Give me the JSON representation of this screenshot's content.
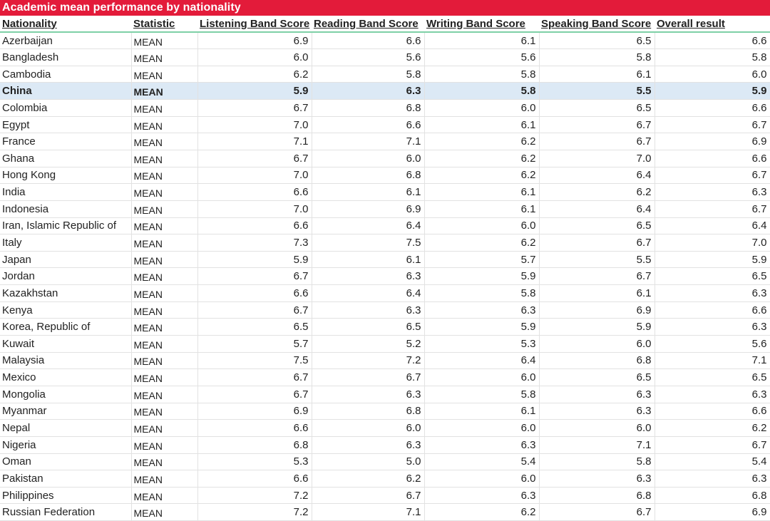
{
  "title": "Academic mean performance by nationality",
  "accent": "#e31b3a",
  "highlight_row": "China",
  "columns": [
    "Nationality",
    "Statistic",
    "Listening Band Score",
    "Reading Band Score",
    "Writing Band Score",
    "Speaking Band Score",
    "Overall result"
  ],
  "rows": [
    [
      "Azerbaijan",
      "MEAN",
      "6.9",
      "6.6",
      "6.1",
      "6.5",
      "6.6"
    ],
    [
      "Bangladesh",
      "MEAN",
      "6.0",
      "5.6",
      "5.6",
      "5.8",
      "5.8"
    ],
    [
      "Cambodia",
      "MEAN",
      "6.2",
      "5.8",
      "5.8",
      "6.1",
      "6.0"
    ],
    [
      "China",
      "MEAN",
      "5.9",
      "6.3",
      "5.8",
      "5.5",
      "5.9"
    ],
    [
      "Colombia",
      "MEAN",
      "6.7",
      "6.8",
      "6.0",
      "6.5",
      "6.6"
    ],
    [
      "Egypt",
      "MEAN",
      "7.0",
      "6.6",
      "6.1",
      "6.7",
      "6.7"
    ],
    [
      "France",
      "MEAN",
      "7.1",
      "7.1",
      "6.2",
      "6.7",
      "6.9"
    ],
    [
      "Ghana",
      "MEAN",
      "6.7",
      "6.0",
      "6.2",
      "7.0",
      "6.6"
    ],
    [
      "Hong Kong",
      "MEAN",
      "7.0",
      "6.8",
      "6.2",
      "6.4",
      "6.7"
    ],
    [
      "India",
      "MEAN",
      "6.6",
      "6.1",
      "6.1",
      "6.2",
      "6.3"
    ],
    [
      "Indonesia",
      "MEAN",
      "7.0",
      "6.9",
      "6.1",
      "6.4",
      "6.7"
    ],
    [
      "Iran, Islamic Republic of",
      "MEAN",
      "6.6",
      "6.4",
      "6.0",
      "6.5",
      "6.4"
    ],
    [
      "Italy",
      "MEAN",
      "7.3",
      "7.5",
      "6.2",
      "6.7",
      "7.0"
    ],
    [
      "Japan",
      "MEAN",
      "5.9",
      "6.1",
      "5.7",
      "5.5",
      "5.9"
    ],
    [
      "Jordan",
      "MEAN",
      "6.7",
      "6.3",
      "5.9",
      "6.7",
      "6.5"
    ],
    [
      "Kazakhstan",
      "MEAN",
      "6.6",
      "6.4",
      "5.8",
      "6.1",
      "6.3"
    ],
    [
      "Kenya",
      "MEAN",
      "6.7",
      "6.3",
      "6.3",
      "6.9",
      "6.6"
    ],
    [
      "Korea, Republic of",
      "MEAN",
      "6.5",
      "6.5",
      "5.9",
      "5.9",
      "6.3"
    ],
    [
      "Kuwait",
      "MEAN",
      "5.7",
      "5.2",
      "5.3",
      "6.0",
      "5.6"
    ],
    [
      "Malaysia",
      "MEAN",
      "7.5",
      "7.2",
      "6.4",
      "6.8",
      "7.1"
    ],
    [
      "Mexico",
      "MEAN",
      "6.7",
      "6.7",
      "6.0",
      "6.5",
      "6.5"
    ],
    [
      "Mongolia",
      "MEAN",
      "6.7",
      "6.3",
      "5.8",
      "6.3",
      "6.3"
    ],
    [
      "Myanmar",
      "MEAN",
      "6.9",
      "6.8",
      "6.1",
      "6.3",
      "6.6"
    ],
    [
      "Nepal",
      "MEAN",
      "6.6",
      "6.0",
      "6.0",
      "6.0",
      "6.2"
    ],
    [
      "Nigeria",
      "MEAN",
      "6.8",
      "6.3",
      "6.3",
      "7.1",
      "6.7"
    ],
    [
      "Oman",
      "MEAN",
      "5.3",
      "5.0",
      "5.4",
      "5.8",
      "5.4"
    ],
    [
      "Pakistan",
      "MEAN",
      "6.6",
      "6.2",
      "6.0",
      "6.3",
      "6.3"
    ],
    [
      "Philippines",
      "MEAN",
      "7.2",
      "6.7",
      "6.3",
      "6.8",
      "6.8"
    ],
    [
      "Russian Federation",
      "MEAN",
      "7.2",
      "7.1",
      "6.2",
      "6.7",
      "6.9"
    ]
  ]
}
